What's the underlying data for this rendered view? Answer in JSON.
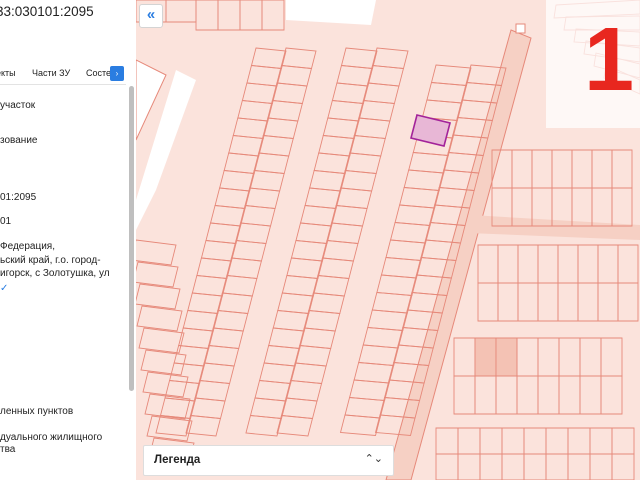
{
  "panel": {
    "cadastral_number": "33:030101:2095",
    "tabs": [
      "екты",
      "Части ЗУ",
      "Состе"
    ],
    "tabs_arrow": "›",
    "rows": [
      {
        "text": "участок"
      },
      {
        "text": "зование"
      },
      {
        "text": "01:2095"
      },
      {
        "text": "01"
      },
      {
        "text": "Федерация,"
      },
      {
        "text": "ьский край, г.о. город-"
      },
      {
        "text": "игорск, с Золотушка, ул"
      },
      {
        "text": "ленных пунктов"
      },
      {
        "text": "дуального жилищного"
      },
      {
        "text": "тва"
      }
    ],
    "check_mark": "✓"
  },
  "map": {
    "collapse_icon": "«",
    "legend_label": "Легенда",
    "legend_arrow": "⌃⌄",
    "zone_number": "1",
    "colors": {
      "background": "#fbe3dc",
      "parcel_stroke": "#e6897a",
      "selected_fill": "#e8b7d6",
      "selected_stroke": "#a3239a",
      "road": "#ffffff",
      "zone_number": "#e8271f"
    }
  }
}
